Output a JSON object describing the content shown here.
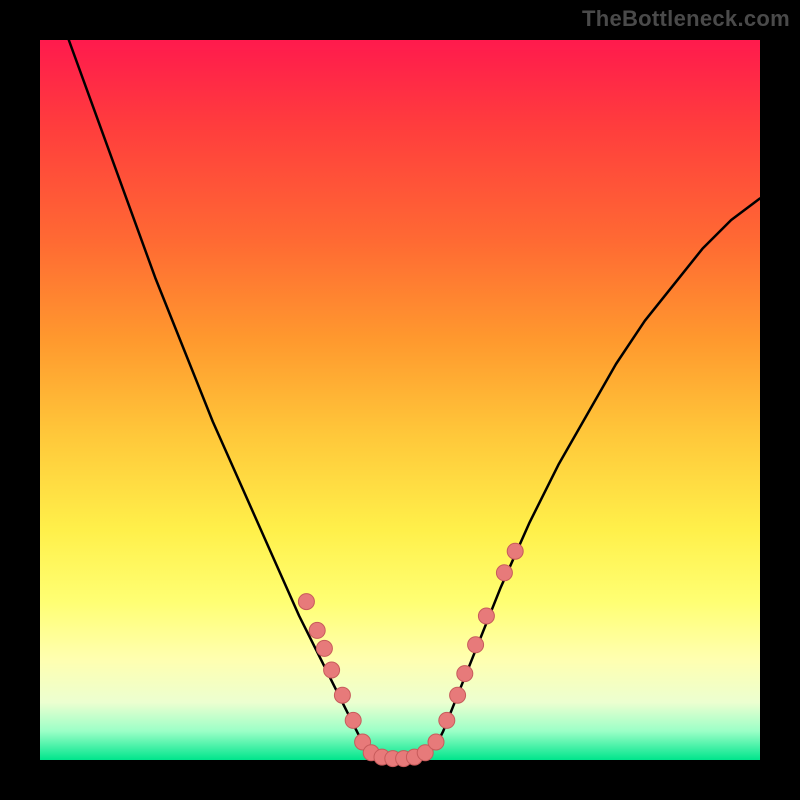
{
  "watermark": "TheBottleneck.com",
  "colors": {
    "curve_stroke": "#000000",
    "marker_fill": "#e77a7a",
    "marker_stroke": "#c75b5b"
  },
  "chart_data": {
    "type": "line",
    "title": "",
    "xlabel": "",
    "ylabel": "",
    "xlim": [
      0,
      100
    ],
    "ylim": [
      0,
      100
    ],
    "curve": {
      "comment": "Estimated bottleneck-style V curve; y=0 is flat green zone at bottom, y=100 is top red.",
      "x": [
        4,
        8,
        12,
        16,
        20,
        24,
        28,
        32,
        36,
        38,
        40,
        42,
        44,
        45,
        46,
        48,
        50,
        52,
        54,
        55,
        56,
        58,
        60,
        64,
        68,
        72,
        76,
        80,
        84,
        88,
        92,
        96,
        100
      ],
      "y": [
        100,
        89,
        78,
        67,
        57,
        47,
        38,
        29,
        20,
        16,
        12,
        8,
        4,
        2,
        1,
        0,
        0,
        0,
        1,
        2,
        4,
        9,
        14,
        24,
        33,
        41,
        48,
        55,
        61,
        66,
        71,
        75,
        78
      ]
    },
    "markers": {
      "comment": "Salmon dots near the trough and lower arms, read from pixels as x% across, y% up.",
      "points": [
        {
          "x": 37.0,
          "y": 22.0
        },
        {
          "x": 38.5,
          "y": 18.0
        },
        {
          "x": 39.5,
          "y": 15.5
        },
        {
          "x": 40.5,
          "y": 12.5
        },
        {
          "x": 42.0,
          "y": 9.0
        },
        {
          "x": 43.5,
          "y": 5.5
        },
        {
          "x": 44.8,
          "y": 2.5
        },
        {
          "x": 46.0,
          "y": 1.0
        },
        {
          "x": 47.5,
          "y": 0.4
        },
        {
          "x": 49.0,
          "y": 0.2
        },
        {
          "x": 50.5,
          "y": 0.2
        },
        {
          "x": 52.0,
          "y": 0.4
        },
        {
          "x": 53.5,
          "y": 1.0
        },
        {
          "x": 55.0,
          "y": 2.5
        },
        {
          "x": 56.5,
          "y": 5.5
        },
        {
          "x": 58.0,
          "y": 9.0
        },
        {
          "x": 59.0,
          "y": 12.0
        },
        {
          "x": 60.5,
          "y": 16.0
        },
        {
          "x": 62.0,
          "y": 20.0
        },
        {
          "x": 64.5,
          "y": 26.0
        },
        {
          "x": 66.0,
          "y": 29.0
        }
      ]
    }
  }
}
